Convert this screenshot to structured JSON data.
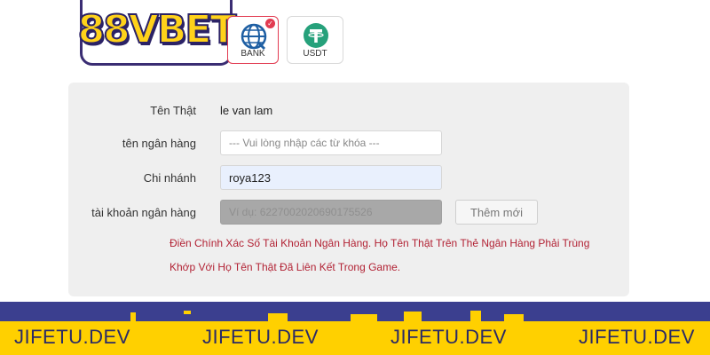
{
  "brand": {
    "logo_text": "88VBET"
  },
  "methods": [
    {
      "label": "BANK",
      "icon": "globe-icon",
      "selected": true,
      "color": "#1e5fa3"
    },
    {
      "label": "USDT",
      "icon": "tether-icon",
      "selected": false,
      "color": "#26a17b"
    }
  ],
  "form": {
    "real_name_label": "Tên Thật",
    "real_name_value": "le van lam",
    "bank_name_label": "tên ngân hàng",
    "bank_name_placeholder": "--- Vui lòng nhập các từ khóa ---",
    "branch_label": "Chi nhánh",
    "branch_value": "roya123",
    "account_label": "tài khoản ngân hàng",
    "account_placeholder": "Ví dụ: 6227002020690175526",
    "add_button": "Thêm mới"
  },
  "notice": {
    "line1": "Điền Chính Xác Số Tài Khoản Ngân Hàng. Họ Tên Thật Trên Thẻ Ngân Hàng Phải Trùng",
    "line2": "Khớp Với Họ Tên Thật Đã Liên Kết Trong Game."
  },
  "watermark": [
    "JIFETU.DEV",
    "JIFETU.DEV",
    "JIFETU.DEV",
    "JIFETU.DEV"
  ],
  "colors": {
    "accent_red": "#e23b51",
    "banner_blue": "#3b3f8f",
    "banner_yellow": "#ffd000",
    "notice_red": "#b22234"
  }
}
